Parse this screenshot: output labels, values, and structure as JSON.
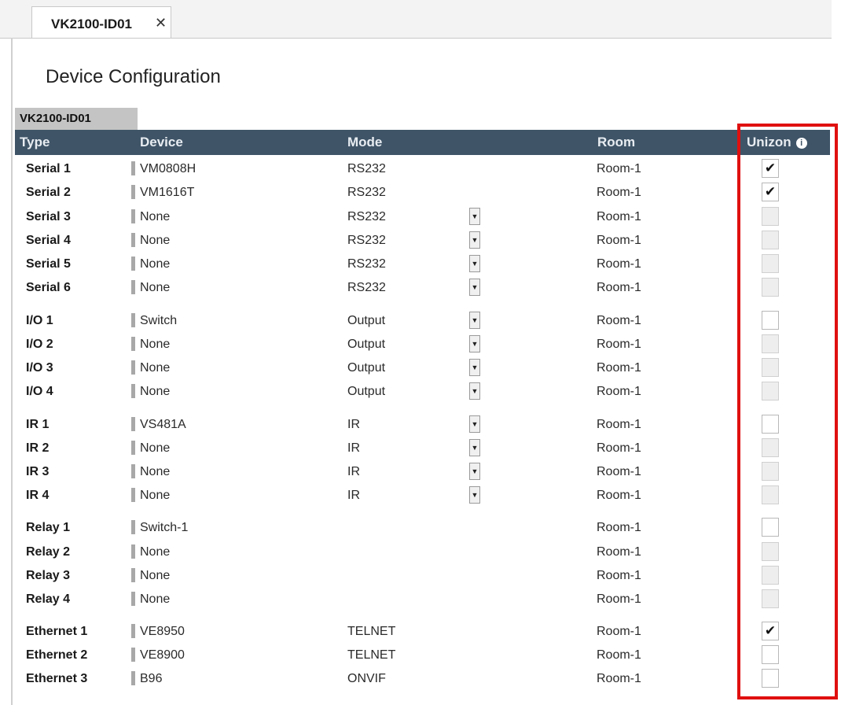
{
  "tab": {
    "label": "VK2100-ID01",
    "close_icon": "close-icon"
  },
  "page_title": "Device Configuration",
  "section_label": "VK2100-ID01",
  "columns": {
    "type": "Type",
    "device": "Device",
    "mode": "Mode",
    "room": "Room",
    "unizon": "Unizon",
    "unizon_icon": "info-icon"
  },
  "rows": [
    {
      "type": "Serial 1",
      "device": "VM0808H",
      "mode": "RS232",
      "dropdown": false,
      "room": "Room-1",
      "unizon": "checked"
    },
    {
      "type": "Serial 2",
      "device": "VM1616T",
      "mode": "RS232",
      "dropdown": false,
      "room": "Room-1",
      "unizon": "checked"
    },
    {
      "type": "Serial 3",
      "device": "None",
      "mode": "RS232",
      "dropdown": true,
      "room": "Room-1",
      "unizon": "disabled"
    },
    {
      "type": "Serial 4",
      "device": "None",
      "mode": "RS232",
      "dropdown": true,
      "room": "Room-1",
      "unizon": "disabled"
    },
    {
      "type": "Serial 5",
      "device": "None",
      "mode": "RS232",
      "dropdown": true,
      "room": "Room-1",
      "unizon": "disabled"
    },
    {
      "type": "Serial 6",
      "device": "None",
      "mode": "RS232",
      "dropdown": true,
      "room": "Room-1",
      "unizon": "disabled"
    },
    {
      "type": "I/O 1",
      "device": "Switch",
      "mode": "Output",
      "dropdown": true,
      "room": "Room-1",
      "unizon": "unchecked"
    },
    {
      "type": "I/O 2",
      "device": "None",
      "mode": "Output",
      "dropdown": true,
      "room": "Room-1",
      "unizon": "disabled"
    },
    {
      "type": "I/O 3",
      "device": "None",
      "mode": "Output",
      "dropdown": true,
      "room": "Room-1",
      "unizon": "disabled"
    },
    {
      "type": "I/O 4",
      "device": "None",
      "mode": "Output",
      "dropdown": true,
      "room": "Room-1",
      "unizon": "disabled"
    },
    {
      "type": "IR 1",
      "device": "VS481A",
      "mode": "IR",
      "dropdown": true,
      "room": "Room-1",
      "unizon": "unchecked"
    },
    {
      "type": "IR 2",
      "device": "None",
      "mode": "IR",
      "dropdown": true,
      "room": "Room-1",
      "unizon": "disabled"
    },
    {
      "type": "IR 3",
      "device": "None",
      "mode": "IR",
      "dropdown": true,
      "room": "Room-1",
      "unizon": "disabled"
    },
    {
      "type": "IR 4",
      "device": "None",
      "mode": "IR",
      "dropdown": true,
      "room": "Room-1",
      "unizon": "disabled"
    },
    {
      "type": "Relay 1",
      "device": "Switch-1",
      "mode": "",
      "dropdown": false,
      "room": "Room-1",
      "unizon": "unchecked"
    },
    {
      "type": "Relay 2",
      "device": "None",
      "mode": "",
      "dropdown": false,
      "room": "Room-1",
      "unizon": "disabled"
    },
    {
      "type": "Relay 3",
      "device": "None",
      "mode": "",
      "dropdown": false,
      "room": "Room-1",
      "unizon": "disabled"
    },
    {
      "type": "Relay 4",
      "device": "None",
      "mode": "",
      "dropdown": false,
      "room": "Room-1",
      "unizon": "disabled"
    },
    {
      "type": "Ethernet 1",
      "device": "VE8950",
      "mode": "TELNET",
      "dropdown": false,
      "room": "Room-1",
      "unizon": "checked"
    },
    {
      "type": "Ethernet 2",
      "device": "VE8900",
      "mode": "TELNET",
      "dropdown": false,
      "room": "Room-1",
      "unizon": "unchecked"
    },
    {
      "type": "Ethernet 3",
      "device": "B96",
      "mode": "ONVIF",
      "dropdown": false,
      "room": "Room-1",
      "unizon": "unchecked"
    }
  ],
  "colors": {
    "header_bg": "#3f5467",
    "highlight": "#e01010",
    "section_bg": "#c4c4c4"
  }
}
